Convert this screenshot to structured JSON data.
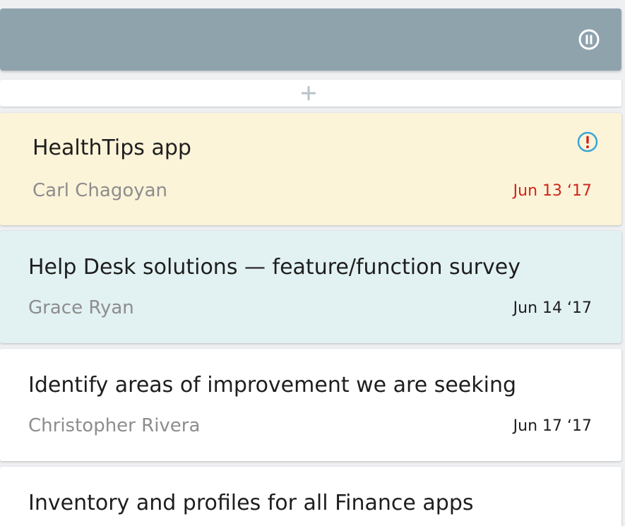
{
  "colors": {
    "header": "#8fa3ad",
    "overdue_card": "#fcf4d9",
    "highlight_card": "#e2f1f2",
    "default_card": "#ffffff",
    "overdue_date": "#d0241b",
    "alert_icon": "#3aa6d6",
    "alert_mark": "#d0241b"
  },
  "header": {
    "icon": "pause-circle-icon"
  },
  "add_bar": {
    "icon": "plus-icon"
  },
  "cards": [
    {
      "title": "HealthTips app",
      "owner": "Carl Chagoyan",
      "date": "Jun 13 ‘17",
      "overdue": true,
      "icon": "alert-icon"
    },
    {
      "title": "Help Desk solutions — feature/function survey",
      "owner": "Grace Ryan",
      "date": "Jun 14 ‘17"
    },
    {
      "title": "Identify areas of improvement we are seeking",
      "owner": "Christopher Rivera",
      "date": "Jun 17 ‘17"
    },
    {
      "title": "Inventory and profiles for all Finance apps"
    }
  ]
}
